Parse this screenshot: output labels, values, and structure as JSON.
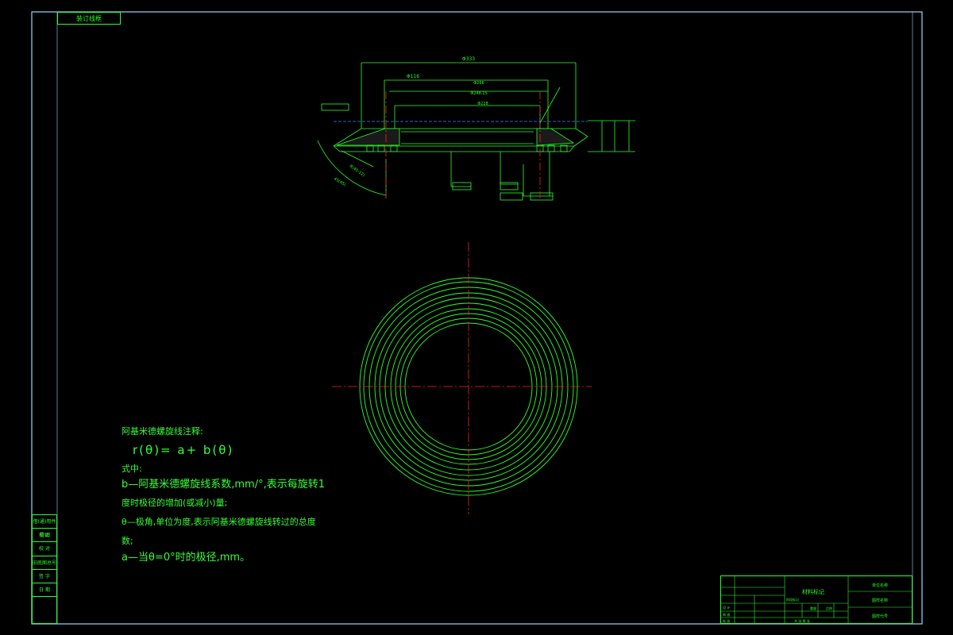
{
  "drawing": {
    "top_tag": "装订线框",
    "dims": {
      "d_outer": "Φ333",
      "d_left": "Φ116",
      "d_mid1": "Φ266",
      "d_mid2": "Φ248.25",
      "d_inner": "Φ228",
      "r_label": "R",
      "angle1": "R(45-12)",
      "angle2": "45(45)"
    },
    "notes": {
      "heading": "阿基米德螺旋线注释:",
      "formula": "r(θ)= a+ b(θ)",
      "where": "式中:",
      "b_def_1": "b—阿基米德螺旋线系数,mm/°,表示每旋转1",
      "b_def_2": "度时极径的增加(或减小)量;",
      "theta_def_1": "θ—极角,单位为度,表示阿基米德螺旋线转过的总度",
      "theta_def_2": "数;",
      "a_def": "a—当θ=0°时的极径,mm。"
    },
    "side_table": [
      "借(通)用件登记",
      "描 图",
      "校 对",
      "旧底图总号",
      "签 字",
      "日 期"
    ],
    "title_block": {
      "material": "材料标记",
      "unit": "单位名称",
      "drawing_name": "图样名称",
      "drawing_code": "图样代号",
      "stage": "阶段标记",
      "weight": "重量",
      "scale": "比例",
      "design": "设 计",
      "check": "审 核",
      "approve": "批 准",
      "sheet": "共 张 第 张"
    },
    "colors": {
      "line": "#2cff2c",
      "centerline": "#ff2020",
      "dimension": "#3b8cff",
      "border": "#7fd7ff",
      "background": "#000000"
    }
  }
}
